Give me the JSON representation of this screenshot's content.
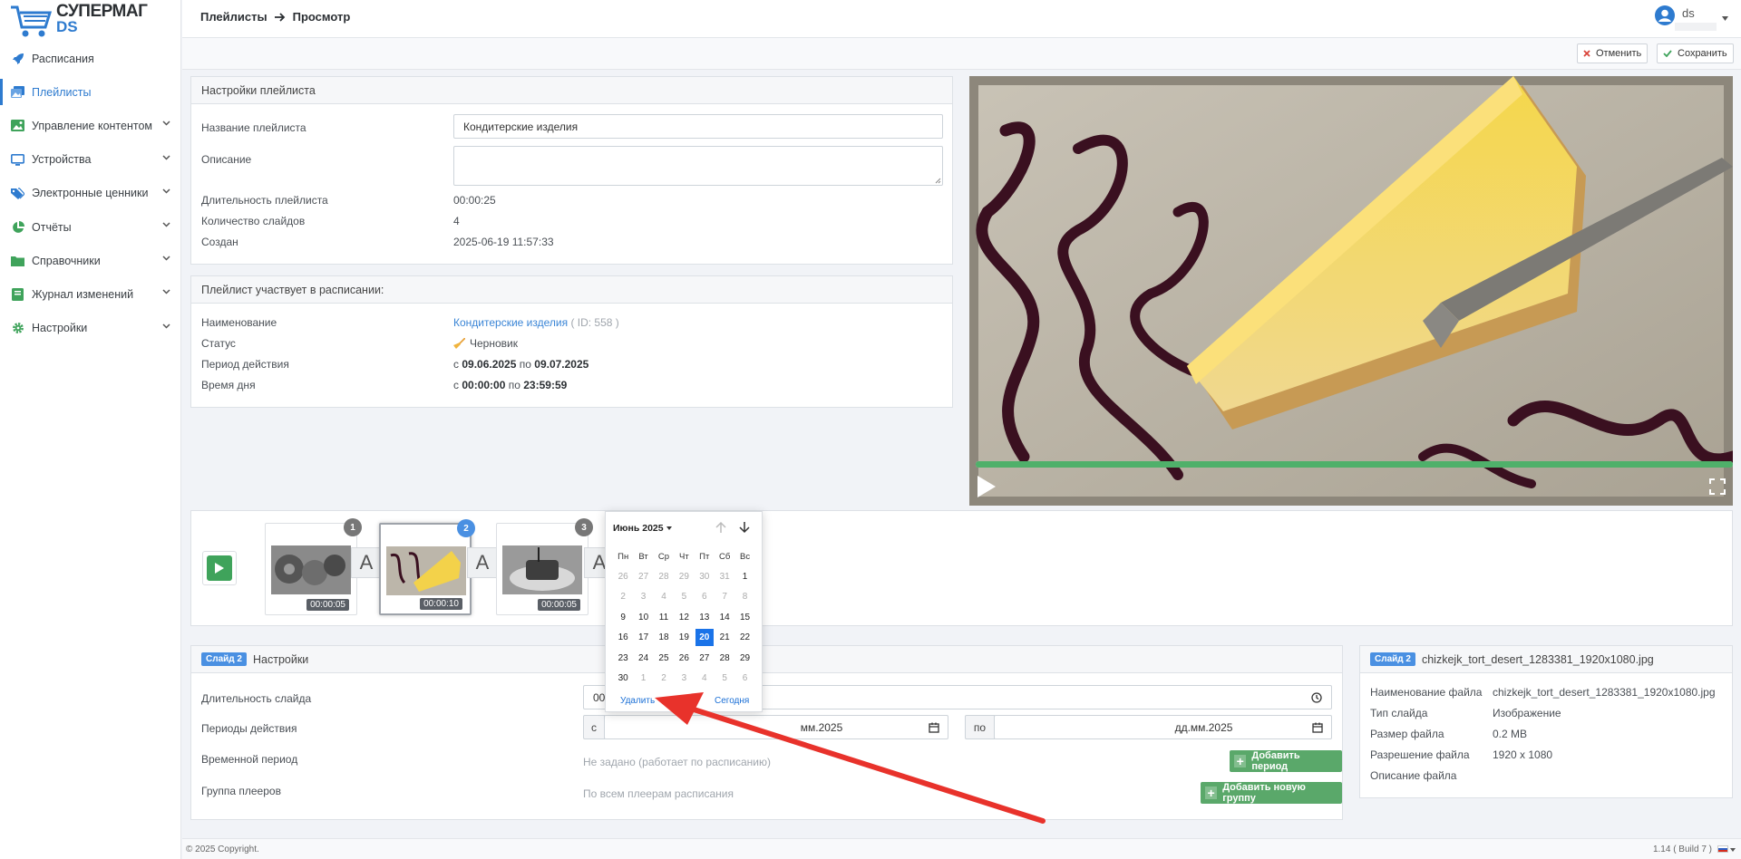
{
  "app": {
    "logo_line1": "СУПЕРМАГ",
    "logo_line2": "DS"
  },
  "sidebar": {
    "items": [
      {
        "label": "Расписания",
        "icon": "rocket-icon"
      },
      {
        "label": "Плейлисты",
        "icon": "images-icon",
        "active": true
      },
      {
        "label": "Управление контентом",
        "icon": "content-icon"
      },
      {
        "label": "Устройства",
        "icon": "monitor-icon"
      },
      {
        "label": "Электронные ценники",
        "icon": "tags-icon"
      },
      {
        "label": "Отчёты",
        "icon": "pie-chart-icon"
      },
      {
        "label": "Справочники",
        "icon": "folder-icon"
      },
      {
        "label": "Журнал изменений",
        "icon": "journal-icon"
      },
      {
        "label": "Настройки",
        "icon": "gear-icon"
      }
    ]
  },
  "header": {
    "crumb1": "Плейлисты",
    "crumb2": "Просмотр",
    "user": "ds"
  },
  "toolbar": {
    "cancel": "Отменить",
    "save": "Сохранить"
  },
  "settings": {
    "title": "Настройки плейлиста",
    "name_label": "Название плейлиста",
    "name_value": "Кондитерские изделия",
    "desc_label": "Описание",
    "duration_label": "Длительность плейлиста",
    "duration_value": "00:00:25",
    "count_label": "Количество слайдов",
    "count_value": "4",
    "created_label": "Создан",
    "created_value": "2025-06-19 11:57:33"
  },
  "schedule": {
    "title": "Плейлист участвует в расписании:",
    "name_label": "Наименование",
    "name_value": "Кондитерские изделия",
    "id_text": "( ID: 558 )",
    "status_label": "Статус",
    "status_value": "Черновик",
    "period_label": "Период действия",
    "period_from_word": "с",
    "period_from": "09.06.2025",
    "period_to_word": "по",
    "period_to": "09.07.2025",
    "time_label": "Время дня",
    "time_from": "00:00:00",
    "time_to": "23:59:59"
  },
  "slides": [
    {
      "num": "1",
      "duration": "00:00:05"
    },
    {
      "num": "2",
      "duration": "00:00:10"
    },
    {
      "num": "3",
      "duration": "00:00:05"
    }
  ],
  "transition_letter": "A",
  "slide_settings": {
    "tag": "Слайд 2",
    "title": "Настройки",
    "duration_label": "Длительность слайда",
    "duration_value": "00",
    "periods_label": "Периоды действия",
    "from_word": "с",
    "to_word": "по",
    "date_from_partial": "мм.2025",
    "date_to_placeholder": "дд.мм.2025",
    "time_period_label": "Временной период",
    "time_period_value": "Не задано (работает по расписанию)",
    "add_period": "Добавить период",
    "group_label": "Группа плееров",
    "group_value": "По всем плеерам расписания",
    "add_group": "Добавить новую группу"
  },
  "file_info": {
    "tag": "Слайд 2",
    "title": "chizkejk_tort_desert_1283381_1920x1080.jpg",
    "name_label": "Наименование файла",
    "name_value": "chizkejk_tort_desert_1283381_1920x1080.jpg",
    "type_label": "Тип слайда",
    "type_value": "Изображение",
    "size_label": "Размер файла",
    "size_value": "0.2 MB",
    "res_label": "Разрешение файла",
    "res_value": "1920 x 1080",
    "desc_label": "Описание файла"
  },
  "calendar": {
    "month": "Июнь 2025",
    "weekdays": [
      "Пн",
      "Вт",
      "Ср",
      "Чт",
      "Пт",
      "Сб",
      "Вс"
    ],
    "weeks": [
      [
        "26",
        "27",
        "28",
        "29",
        "30",
        "31",
        "1"
      ],
      [
        "2",
        "3",
        "4",
        "5",
        "6",
        "7",
        "8"
      ],
      [
        "9",
        "10",
        "11",
        "12",
        "13",
        "14",
        "15"
      ],
      [
        "16",
        "17",
        "18",
        "19",
        "20",
        "21",
        "22"
      ],
      [
        "23",
        "24",
        "25",
        "26",
        "27",
        "28",
        "29"
      ],
      [
        "30",
        "1",
        "2",
        "3",
        "4",
        "5",
        "6"
      ]
    ],
    "today": "20",
    "delete": "Удалить",
    "today_btn": "Сегодня"
  },
  "video": {
    "progress": 1.0
  },
  "footer": {
    "copyright": "© 2025 Copyright.",
    "version": "1.14 ( Build 7 )"
  },
  "colors": {
    "accent": "#2e7bcf",
    "green": "#5aa86a",
    "arrow": "#e8322b"
  }
}
